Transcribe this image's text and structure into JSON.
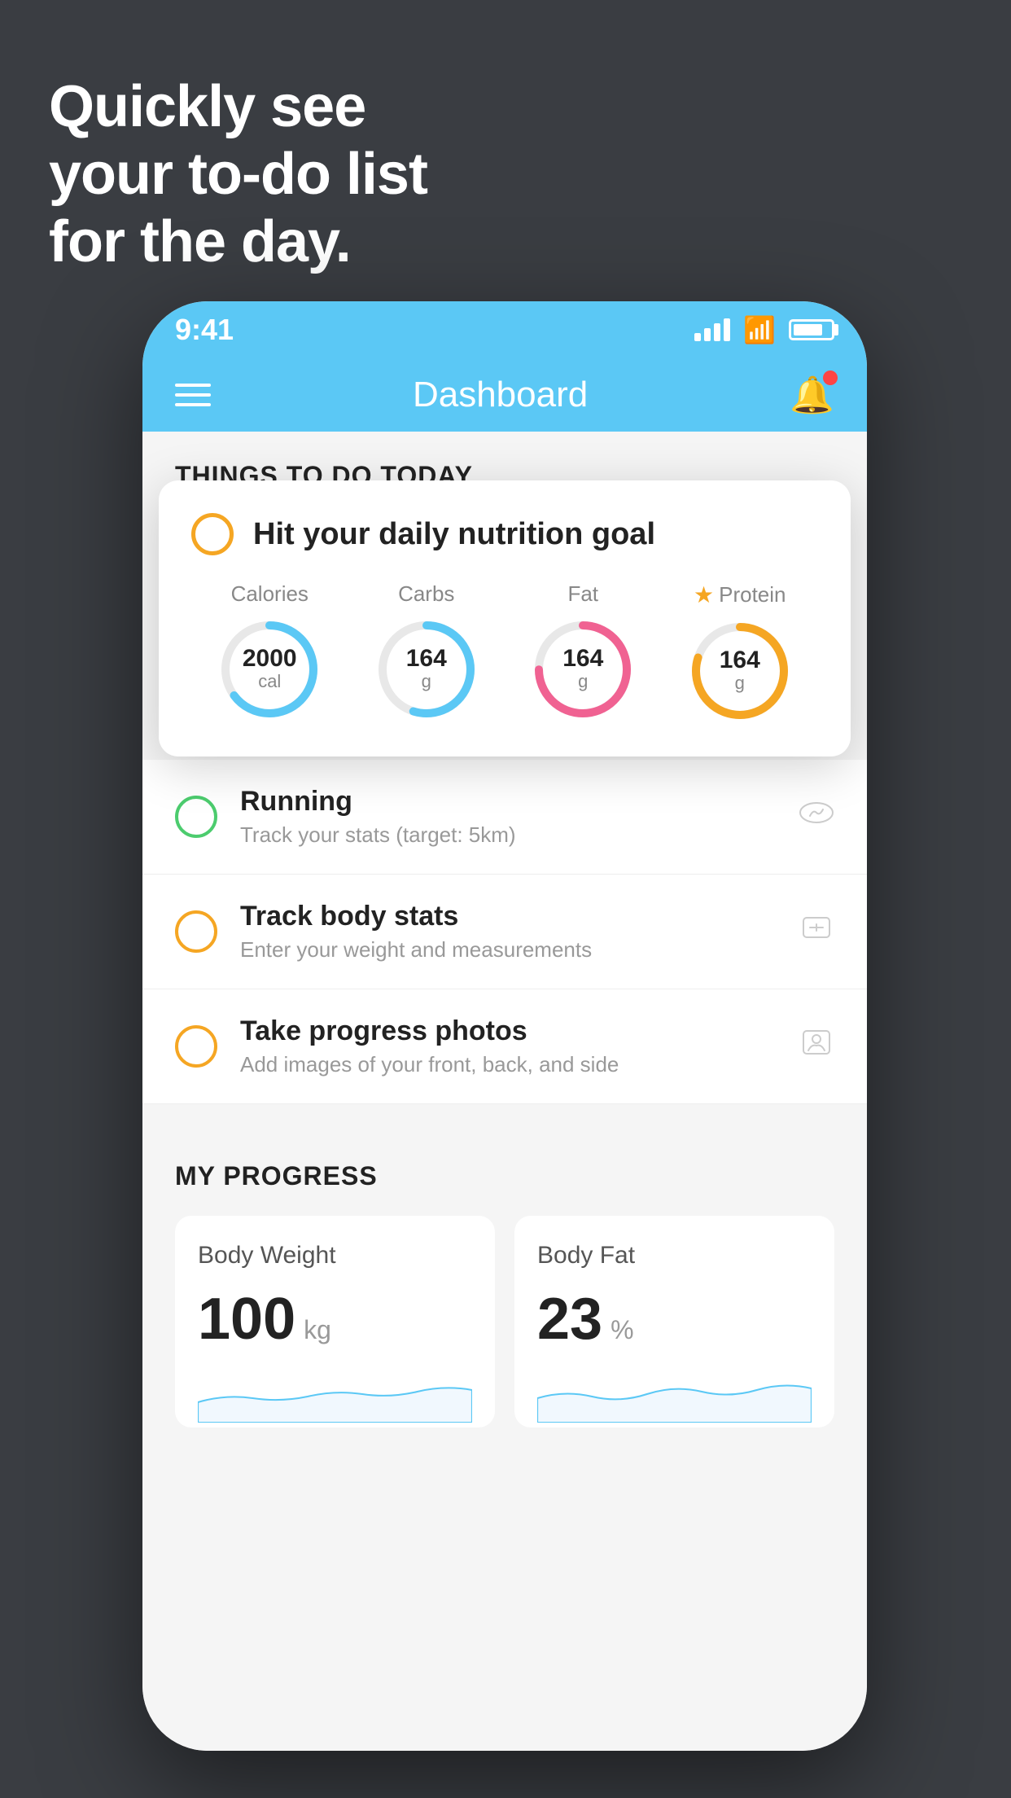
{
  "hero": {
    "line1": "Quickly see",
    "line2": "your to-do list",
    "line3": "for the day."
  },
  "statusBar": {
    "time": "9:41"
  },
  "navbar": {
    "title": "Dashboard"
  },
  "thingsToDo": {
    "sectionTitle": "THINGS TO DO TODAY",
    "nutritionCard": {
      "title": "Hit your daily nutrition goal",
      "stats": [
        {
          "label": "Calories",
          "value": "2000",
          "unit": "cal",
          "color": "#5bc8f5",
          "percent": 65,
          "star": false
        },
        {
          "label": "Carbs",
          "value": "164",
          "unit": "g",
          "color": "#5bc8f5",
          "percent": 55,
          "star": false
        },
        {
          "label": "Fat",
          "value": "164",
          "unit": "g",
          "color": "#f06292",
          "percent": 75,
          "star": false
        },
        {
          "label": "Protein",
          "value": "164",
          "unit": "g",
          "color": "#f5a623",
          "percent": 80,
          "star": true
        }
      ]
    },
    "items": [
      {
        "id": "running",
        "title": "Running",
        "subtitle": "Track your stats (target: 5km)",
        "circleColor": "green",
        "icon": "👟"
      },
      {
        "id": "track-body-stats",
        "title": "Track body stats",
        "subtitle": "Enter your weight and measurements",
        "circleColor": "yellow",
        "icon": "⚖️"
      },
      {
        "id": "progress-photos",
        "title": "Take progress photos",
        "subtitle": "Add images of your front, back, and side",
        "circleColor": "yellow",
        "icon": "🖼️"
      }
    ]
  },
  "myProgress": {
    "sectionTitle": "MY PROGRESS",
    "cards": [
      {
        "title": "Body Weight",
        "value": "100",
        "unit": "kg"
      },
      {
        "title": "Body Fat",
        "value": "23",
        "unit": "%"
      }
    ]
  }
}
